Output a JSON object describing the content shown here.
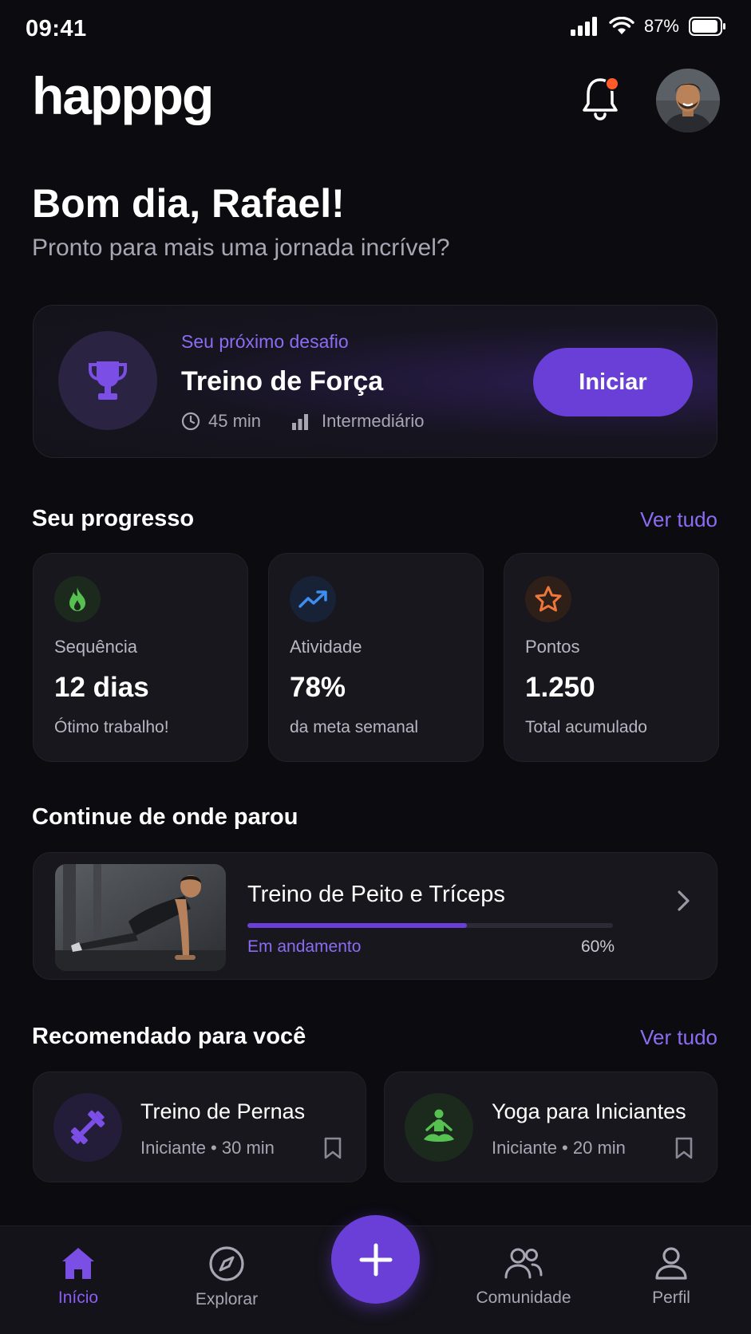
{
  "status_bar": {
    "time": "09:41",
    "battery": "87%"
  },
  "header": {
    "logo": "happpg"
  },
  "greeting": {
    "title": "Bom dia, Rafael!",
    "subtitle": "Pronto para mais uma jornada incrível?"
  },
  "challenge": {
    "label": "Seu próximo desafio",
    "title": "Treino de Força",
    "duration": "45 min",
    "level": "Intermediário",
    "button": "Iniciar"
  },
  "progress": {
    "title": "Seu progresso",
    "see_all": "Ver tudo",
    "cards": [
      {
        "icon": "flame-icon",
        "label": "Sequência",
        "value": "12 dias",
        "sub": "Ótimo trabalho!"
      },
      {
        "icon": "trending-up-icon",
        "label": "Atividade",
        "value": "78%",
        "sub": "da meta semanal"
      },
      {
        "icon": "star-icon",
        "label": "Pontos",
        "value": "1.250",
        "sub": "Total acumulado"
      }
    ]
  },
  "continue": {
    "title": "Continue de onde parou",
    "workout": "Treino de Peito e Tríceps",
    "status": "Em andamento",
    "percent_label": "60%",
    "progress": 0.6
  },
  "recommended": {
    "title": "Recomendado para você",
    "see_all": "Ver tudo",
    "items": [
      {
        "icon": "dumbbell-icon",
        "title": "Treino de Pernas",
        "meta": "Iniciante • 30 min"
      },
      {
        "icon": "yoga-icon",
        "title": "Yoga para Iniciantes",
        "meta": "Iniciante • 20 min"
      }
    ]
  },
  "nav": {
    "items": [
      {
        "icon": "home-icon",
        "label": "Início",
        "active": true
      },
      {
        "icon": "compass-icon",
        "label": "Explorar"
      },
      {
        "icon": "users-icon",
        "label": "Comunidade"
      },
      {
        "icon": "user-icon",
        "label": "Perfil"
      }
    ]
  },
  "colors": {
    "accent": "#6a3fd7",
    "accent_text": "#8b6cf2",
    "background": "#0c0b10",
    "card": "#18171d",
    "notification_dot": "#ff5a2a"
  }
}
